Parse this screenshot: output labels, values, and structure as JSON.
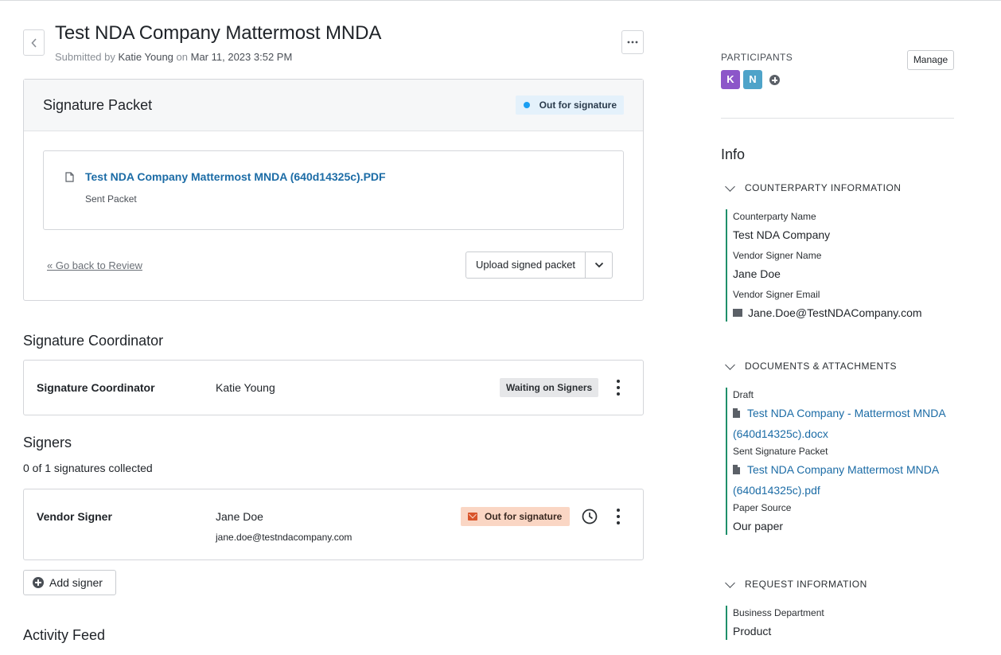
{
  "header": {
    "title": "Test NDA Company Mattermost MNDA",
    "submitted_prefix": "Submitted by",
    "submitted_by": "Katie Young",
    "submitted_on_word": "on",
    "submitted_date": "Mar 11, 2023 3:52 PM"
  },
  "packet": {
    "title": "Signature Packet",
    "status": "Out for signature",
    "file_name": "Test NDA Company Mattermost MNDA (640d14325c).PDF",
    "file_caption": "Sent Packet",
    "go_back": "« Go back to Review",
    "upload_label": "Upload signed packet"
  },
  "coordinator": {
    "section_title": "Signature Coordinator",
    "row_label": "Signature Coordinator",
    "name": "Katie Young",
    "status": "Waiting on Signers"
  },
  "signers": {
    "section_title": "Signers",
    "collected": "0 of 1 signatures collected",
    "rows": [
      {
        "role": "Vendor Signer",
        "name": "Jane Doe",
        "email": "jane.doe@testndacompany.com",
        "status": "Out for signature"
      }
    ],
    "add_label": "Add signer"
  },
  "activity": {
    "section_title": "Activity Feed"
  },
  "sidebar": {
    "participants_title": "PARTICIPANTS",
    "manage_label": "Manage",
    "avatars": [
      {
        "initial": "K",
        "color": "#8c56c9"
      },
      {
        "initial": "N",
        "color": "#4ea3c9"
      }
    ],
    "info_title": "Info",
    "groups": {
      "counterparty": {
        "title": "COUNTERPARTY INFORMATION",
        "fields": [
          {
            "label": "Counterparty Name",
            "value": "Test NDA Company"
          },
          {
            "label": "Vendor Signer Name",
            "value": "Jane Doe"
          },
          {
            "label": "Vendor Signer Email",
            "value": "Jane.Doe@TestNDACompany.com"
          }
        ]
      },
      "documents": {
        "title": "DOCUMENTS & ATTACHMENTS",
        "draft_label": "Draft",
        "draft_link": "Test NDA Company - Mattermost MNDA (640d14325c).docx",
        "sent_label": "Sent Signature Packet",
        "sent_link": "Test NDA Company Mattermost MNDA (640d14325c).pdf",
        "paper_label": "Paper Source",
        "paper_value": "Our paper"
      },
      "request": {
        "title": "REQUEST INFORMATION",
        "dept_label": "Business Department",
        "dept_value": "Product"
      }
    }
  },
  "colors": {
    "accent_link": "#1c6ca6",
    "status_blue": "#1a9ef2",
    "status_orange_bg": "#fad6c4",
    "group_border": "#1e8f6a"
  },
  "icons": [
    "chevron-left-icon",
    "ellipsis-icon",
    "document-icon",
    "chevron-down-icon",
    "kebab-icon",
    "clock-icon",
    "mail-icon",
    "plus-circle-icon"
  ]
}
